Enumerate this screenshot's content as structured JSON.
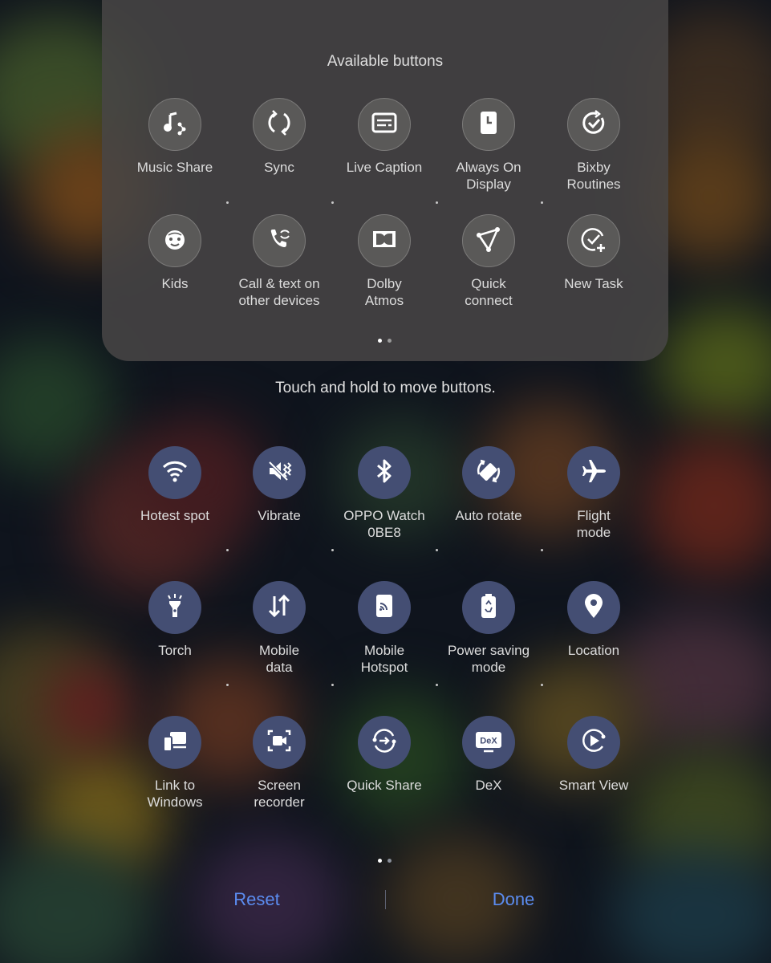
{
  "available": {
    "title": "Available buttons",
    "tiles": [
      {
        "label": "Music Share",
        "icon": "music-share-icon"
      },
      {
        "label": "Sync",
        "icon": "sync-icon"
      },
      {
        "label": "Live Caption",
        "icon": "live-caption-icon"
      },
      {
        "label": "Always On\nDisplay",
        "icon": "always-on-display-icon"
      },
      {
        "label": "Bixby\nRoutines",
        "icon": "bixby-routines-icon"
      },
      {
        "label": "Kids",
        "icon": "kids-icon"
      },
      {
        "label": "Call & text on\nother devices",
        "icon": "call-text-icon"
      },
      {
        "label": "Dolby\nAtmos",
        "icon": "dolby-atmos-icon"
      },
      {
        "label": "Quick\nconnect",
        "icon": "quick-connect-icon"
      },
      {
        "label": "New Task",
        "icon": "new-task-icon"
      }
    ],
    "pager": {
      "pages": 2,
      "current": 1
    }
  },
  "hint": "Touch and hold to move buttons.",
  "active": {
    "tiles": [
      {
        "label": "Hotest spot",
        "icon": "wifi-icon"
      },
      {
        "label": "Vibrate",
        "icon": "vibrate-icon"
      },
      {
        "label": "OPPO Watch\n0BE8",
        "icon": "bluetooth-icon"
      },
      {
        "label": "Auto rotate",
        "icon": "auto-rotate-icon"
      },
      {
        "label": "Flight\nmode",
        "icon": "airplane-icon"
      },
      {
        "label": "Torch",
        "icon": "torch-icon"
      },
      {
        "label": "Mobile\ndata",
        "icon": "mobile-data-icon"
      },
      {
        "label": "Mobile\nHotspot",
        "icon": "mobile-hotspot-icon"
      },
      {
        "label": "Power saving\nmode",
        "icon": "power-saving-icon"
      },
      {
        "label": "Location",
        "icon": "location-icon"
      },
      {
        "label": "Link to\nWindows",
        "icon": "link-to-windows-icon"
      },
      {
        "label": "Screen\nrecorder",
        "icon": "screen-recorder-icon"
      },
      {
        "label": "Quick Share",
        "icon": "quick-share-icon"
      },
      {
        "label": "DeX",
        "icon": "dex-icon",
        "badge": "DeX"
      },
      {
        "label": "Smart View",
        "icon": "smart-view-icon"
      }
    ],
    "pager": {
      "pages": 2,
      "current": 1
    }
  },
  "buttons": {
    "reset": "Reset",
    "done": "Done"
  },
  "colors": {
    "accent": "#5b8cf0",
    "active_circle": "#444e73",
    "available_circle": "#5a5958"
  }
}
